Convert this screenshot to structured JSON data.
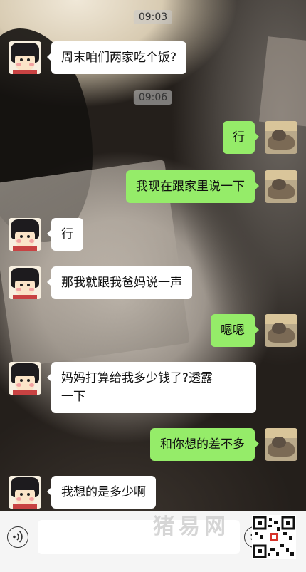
{
  "conversation": {
    "timestamps": {
      "t1": "09:03",
      "t2": "09:06"
    },
    "messages": [
      {
        "side": "left",
        "text": "周末咱们两家吃个饭?"
      },
      {
        "side": "right",
        "text": "行"
      },
      {
        "side": "right",
        "text": "我现在跟家里说一下"
      },
      {
        "side": "left",
        "text": "行"
      },
      {
        "side": "left",
        "text": "那我就跟我爸妈说一声"
      },
      {
        "side": "right",
        "text": "嗯嗯"
      },
      {
        "side": "left",
        "text": "妈妈打算给我多少钱了?透露\n一下"
      },
      {
        "side": "right",
        "text": "和你想的差不多"
      },
      {
        "side": "left",
        "text": "我想的是多少啊"
      }
    ]
  },
  "colors": {
    "sent_bubble": "#95ec69",
    "received_bubble": "#ffffff"
  },
  "bottom_bar": {
    "voice_icon": "voice-icon",
    "emoji_icon": "emoji-icon",
    "input_value": "",
    "watermark": "猪易网"
  }
}
